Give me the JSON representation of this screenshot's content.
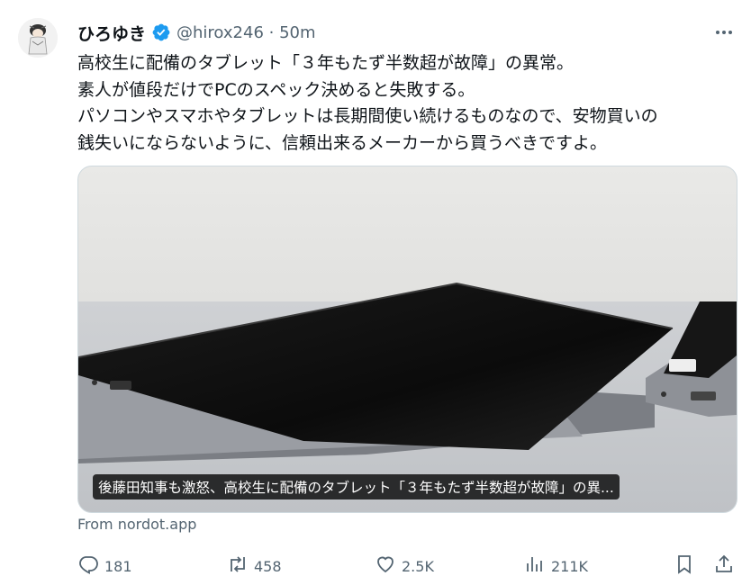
{
  "post": {
    "author_name": "ひろゆき",
    "handle_time": "@hirox246 · 50m",
    "text_lines": [
      "高校生に配備のタブレット「３年もたず半数超が故障」の異常。",
      "素人が値段だけでPCのスペック決めると失敗する。",
      "パソコンやスマホやタブレットは長期間使い続けるものなので、安物買いの",
      "銭失いにならないように、信頼出来るメーカーから買うべきですよ。"
    ]
  },
  "media": {
    "caption": "後藤田知事も激怒、高校生に配備のタブレット「３年もたず半数超が故障」の異..."
  },
  "source": "From nordot.app",
  "actions": {
    "replies": "181",
    "reposts": "458",
    "likes": "2.5K",
    "views": "211K"
  },
  "icons": {
    "verified": "verified-badge-icon",
    "more": "more-options-icon",
    "reply": "reply-icon",
    "repost": "repost-icon",
    "like": "heart-icon",
    "views": "views-icon",
    "bookmark": "bookmark-icon",
    "share": "share-icon"
  },
  "colors": {
    "verified": "#1d9bf0",
    "secondary_text": "#536471",
    "primary_text": "#0f1419"
  }
}
